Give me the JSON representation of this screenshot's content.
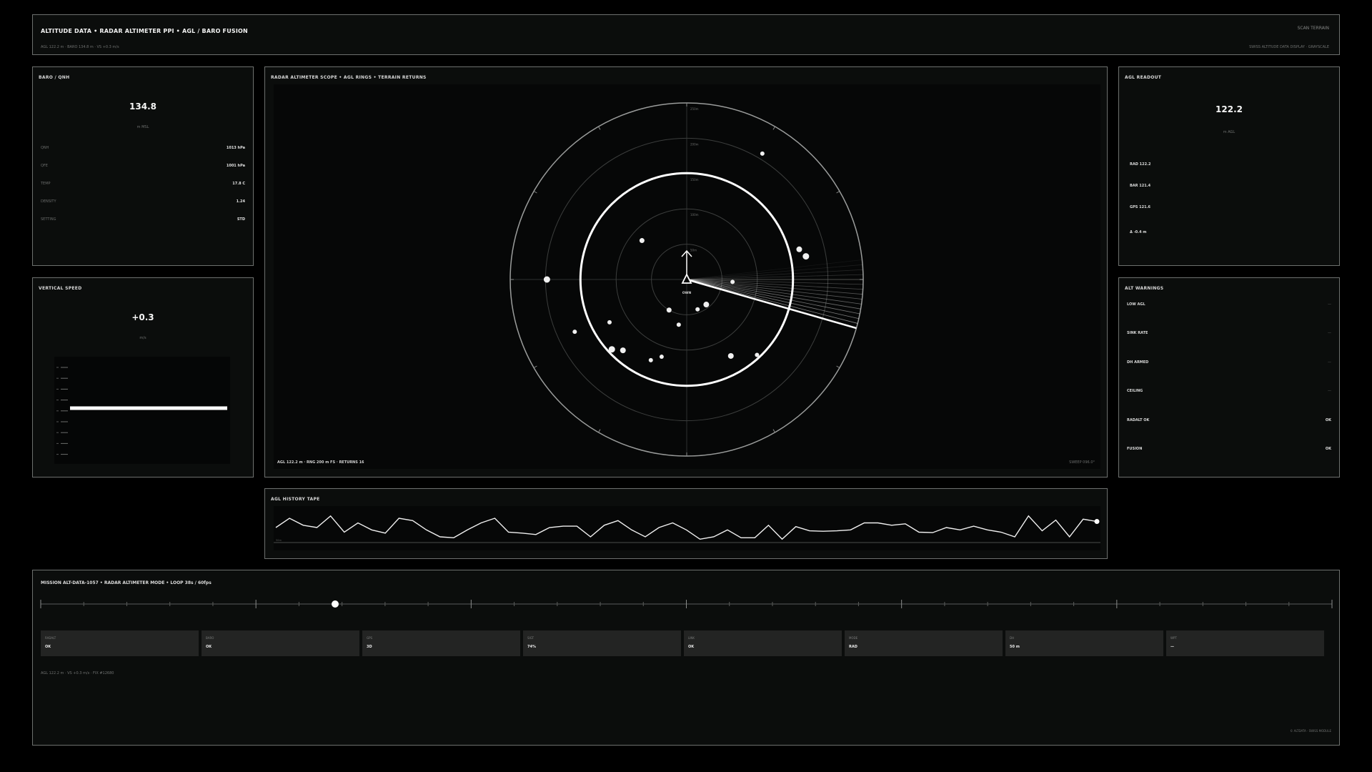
{
  "header": {
    "title": "ALTITUDE DATA  •  RADAR ALTIMETER PPI  •  AGL / BARO FUSION",
    "subtitle": "AGL 122.2 m  ·  BARO 134.8 m  ·  VS +0.3 m/s",
    "scan_button": "SCAN TERRAIN",
    "right_note": "SWISS ALTITUDE DATA DISPLAY  ·  GRAYSCALE"
  },
  "baro": {
    "title": "BARO / QNH",
    "value": "134.8",
    "unit": "m MSL",
    "rows": [
      {
        "k": "QNH",
        "v": "1013 hPa"
      },
      {
        "k": "QFE",
        "v": "1001 hPa"
      },
      {
        "k": "TEMP",
        "v": "17.8 C"
      },
      {
        "k": "DENSITY",
        "v": "1.24"
      },
      {
        "k": "SETTING",
        "v": "STD"
      }
    ]
  },
  "vspeed": {
    "title": "VERTICAL SPEED",
    "value": "+0.3",
    "unit": "m/s",
    "level_fraction": 0.52
  },
  "radar": {
    "title": "RADAR ALTIMETER SCOPE  •  AGL RINGS  •  TERRAIN RETURNS",
    "ring_labels": [
      "250m",
      "200m",
      "150m",
      "100m",
      "50m"
    ],
    "center_label": "OWN",
    "footer": "AGL  122.2 m  ·  RNG  200 m FS  ·  RETURNS  16",
    "sweep_label": "SWEEP  096.0°",
    "sweep_bearing_deg": 106,
    "agl_ring_m": 122.2,
    "max_range_m": 250,
    "returns": [
      {
        "r": 208,
        "b": 31,
        "s": 3
      },
      {
        "r": 165,
        "b": 75,
        "s": 4
      },
      {
        "r": 172,
        "b": 79,
        "s": 4.5
      },
      {
        "r": 198,
        "b": 270,
        "s": 4.5
      },
      {
        "r": 84,
        "b": 311,
        "s": 3.5
      },
      {
        "r": 65,
        "b": 93,
        "s": 3
      },
      {
        "r": 50,
        "b": 210,
        "s": 3.5
      },
      {
        "r": 45,
        "b": 160,
        "s": 3
      },
      {
        "r": 45,
        "b": 142,
        "s": 4
      },
      {
        "r": 65,
        "b": 190,
        "s": 3
      },
      {
        "r": 125,
        "b": 150,
        "s": 4
      },
      {
        "r": 146,
        "b": 137,
        "s": 3
      },
      {
        "r": 115,
        "b": 198,
        "s": 3
      },
      {
        "r": 125,
        "b": 204,
        "s": 3
      },
      {
        "r": 145,
        "b": 227,
        "s": 4.5
      },
      {
        "r": 135,
        "b": 222,
        "s": 4
      },
      {
        "r": 175,
        "b": 245,
        "s": 3
      },
      {
        "r": 125,
        "b": 241,
        "s": 3
      }
    ]
  },
  "agl_readout": {
    "title": "AGL READOUT",
    "value": "122.2",
    "unit": "m AGL",
    "rows": [
      "RAD  122.2",
      "BAR  121.4",
      "GPS  121.6",
      "Δ  -0.4 m"
    ]
  },
  "warnings": {
    "title": "ALT WARNINGS",
    "items": [
      {
        "label": "LOW AGL",
        "status": "—"
      },
      {
        "label": "SINK RATE",
        "status": "—"
      },
      {
        "label": "DH ARMED",
        "status": "—"
      },
      {
        "label": "CEILING",
        "status": "—"
      },
      {
        "label": "RADALT OK",
        "status": "OK"
      },
      {
        "label": "FUSION",
        "status": "OK"
      }
    ]
  },
  "history": {
    "title": "AGL HISTORY TAPE",
    "baseline_label": "50m",
    "values": [
      121,
      123,
      121.5,
      121,
      123.5,
      120,
      122,
      120.5,
      119.8,
      123,
      122.5,
      120.5,
      119,
      118.8,
      120.5,
      122,
      123,
      120,
      119.8,
      119.5,
      121,
      121.3,
      121.3,
      119,
      121.5,
      122.5,
      120.5,
      119,
      121,
      122,
      120.5,
      118.5,
      119,
      120.5,
      118.8,
      118.8,
      121.5,
      118.5,
      121.2,
      120.3,
      120.2,
      120.3,
      120.5,
      122,
      122,
      121.5,
      121.8,
      120,
      119.9,
      121,
      120.5,
      121.3,
      120.5,
      120,
      119,
      123.5,
      120.3,
      122.6,
      119,
      122.8,
      122.3
    ],
    "ylim": [
      117,
      125
    ]
  },
  "mission": {
    "title": "MISSION  ALT-DATA-1057  •  RADAR ALTIMETER MODE  •  LOOP  38s / 60fps",
    "progress": 0.228,
    "cards": [
      {
        "label": "RADALT",
        "value": "OK"
      },
      {
        "label": "BARO",
        "value": "OK"
      },
      {
        "label": "GPS",
        "value": "3D"
      },
      {
        "label": "SIGT",
        "value": "74%"
      },
      {
        "label": "LINK",
        "value": "OK"
      },
      {
        "label": "MODE",
        "value": "RAD"
      },
      {
        "label": "DH",
        "value": "50 m"
      },
      {
        "label": "WPT",
        "value": "—"
      }
    ],
    "footer": "AGL  122.2 m  ·  VS  +0.3 m/s  ·  FIX  #12680",
    "brand": "© ALTDATA  ·  SWISS MODULE"
  }
}
